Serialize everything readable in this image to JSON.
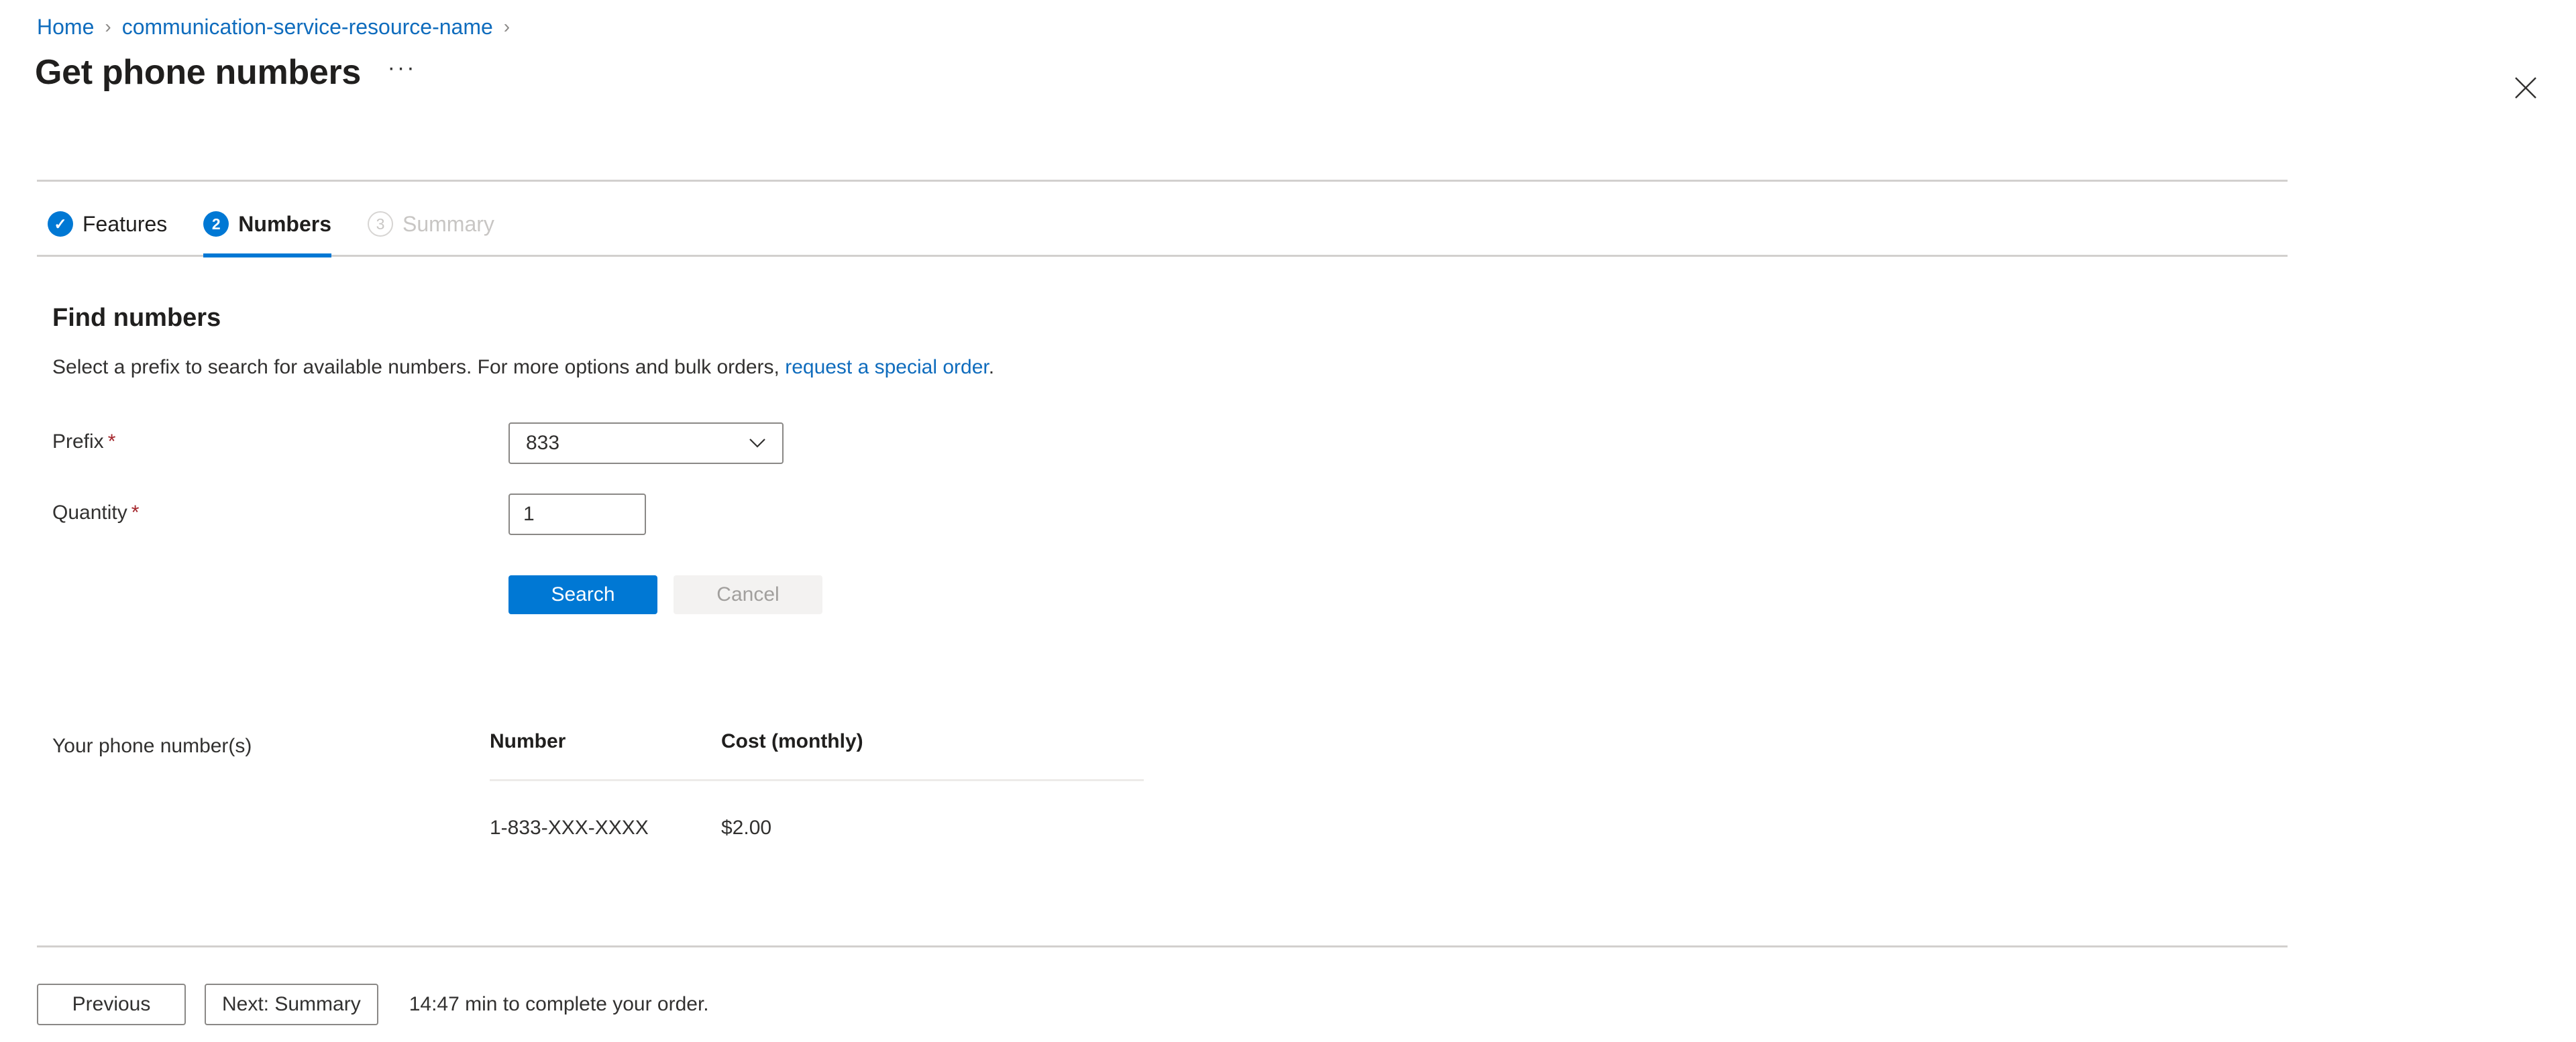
{
  "breadcrumb": {
    "items": [
      {
        "label": "Home"
      },
      {
        "label": "communication-service-resource-name"
      }
    ],
    "separator": "›"
  },
  "header": {
    "title": "Get phone numbers",
    "more_label": "···",
    "close_icon": "close-icon"
  },
  "pivot": {
    "tabs": [
      {
        "badge": "✓",
        "label": "Features",
        "state": "done"
      },
      {
        "badge": "2",
        "label": "Numbers",
        "state": "current"
      },
      {
        "badge": "3",
        "label": "Summary",
        "state": "todo"
      }
    ]
  },
  "section": {
    "title": "Find numbers",
    "description_before": "Select a prefix to search for available numbers. For more options and bulk orders, ",
    "description_link": "request a special order",
    "description_after": "."
  },
  "form": {
    "prefix": {
      "label": "Prefix",
      "required_mark": "*",
      "value": "833",
      "chevron_icon": "chevron-down-icon"
    },
    "quantity": {
      "label": "Quantity",
      "required_mark": "*",
      "value": "1",
      "placeholder": ""
    },
    "search_label": "Search",
    "cancel_label": "Cancel"
  },
  "results": {
    "label": "Your phone number(s)",
    "columns": [
      "Number",
      "Cost (monthly)"
    ],
    "rows": [
      {
        "number": "1-833-XXX-XXXX",
        "cost": "$2.00"
      }
    ]
  },
  "footer": {
    "previous_label": "Previous",
    "next_label": "Next: Summary",
    "note": "14:47 min to complete your order."
  },
  "colors": {
    "accent": "#0078d4",
    "link": "#0f6cbd",
    "required": "#a4262c",
    "divider": "#d2d0ce",
    "disabled_text": "#c8c6c4"
  }
}
